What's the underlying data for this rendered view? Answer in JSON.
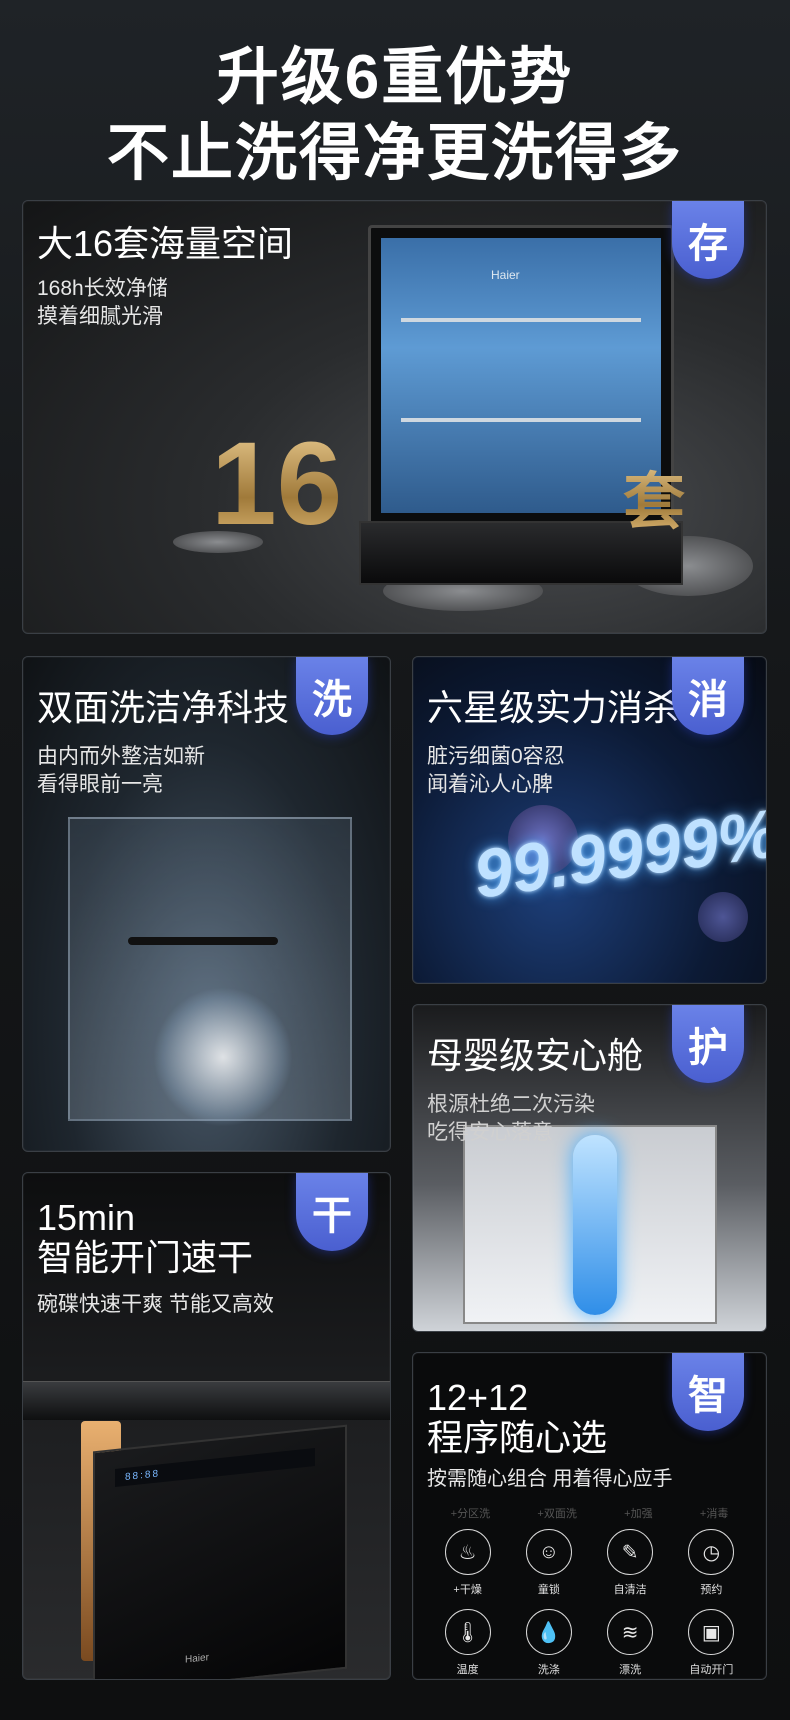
{
  "headline": {
    "line1": "升级6重优势",
    "line2": "不止洗得净更洗得多"
  },
  "storage": {
    "badge": "存",
    "title": "大16套海量空间",
    "sub1": "168h长效净储",
    "sub2": "摸着细腻光滑",
    "big_number": "16",
    "big_unit": "套",
    "brand": "Haier"
  },
  "wash": {
    "badge": "洗",
    "title": "双面洗洁净科技",
    "sub1": "由内而外整洁如新",
    "sub2": "看得眼前一亮"
  },
  "germ": {
    "badge": "消",
    "title": "六星级实力消杀",
    "sub1": "脏污细菌0容忍",
    "sub2": "闻着沁人心脾",
    "percent": "99.9999%"
  },
  "baby": {
    "badge": "护",
    "title": "母婴级安心舱",
    "sub1": "根源杜绝二次污染",
    "sub2": "吃得安心落意"
  },
  "dry": {
    "badge": "干",
    "title1": "15min",
    "title2": "智能开门速干",
    "sub": "碗碟快速干爽 节能又高效",
    "panel_text": "88:88",
    "brand": "Haier"
  },
  "programs": {
    "badge": "智",
    "title1": "12+12",
    "title2": "程序随心选",
    "sub": "按需随心组合 用着得心应手",
    "ghost_labels": [
      "+分区洗",
      "+双面洗",
      "+加强",
      "+消毒"
    ],
    "row1": [
      {
        "icon": "dry-icon",
        "glyph": "♨",
        "label": "+干燥"
      },
      {
        "icon": "child-lock-icon",
        "glyph": "☺",
        "label": "童锁"
      },
      {
        "icon": "self-clean-icon",
        "glyph": "✎",
        "label": "自清洁"
      },
      {
        "icon": "clock-icon",
        "glyph": "◷",
        "label": "预约"
      }
    ],
    "row2": [
      {
        "icon": "thermometer-icon",
        "glyph": "🌡",
        "label": "温度"
      },
      {
        "icon": "detergent-drop-icon",
        "glyph": "💧",
        "label": "洗涤"
      },
      {
        "icon": "rinse-icon",
        "glyph": "≋",
        "label": "漂洗"
      },
      {
        "icon": "auto-door-icon",
        "glyph": "▣",
        "label": "自动开门"
      }
    ]
  },
  "colors": {
    "badge": "#5b70dc",
    "gold": "#d8b070",
    "glow": "#4aa8ff"
  }
}
